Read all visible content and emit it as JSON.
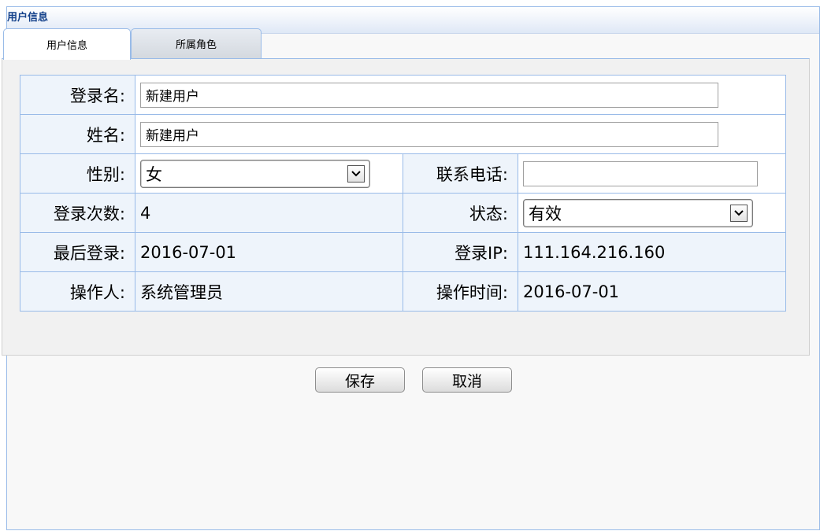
{
  "panel": {
    "title": "用户信息"
  },
  "tabs": [
    {
      "label": "用户信息",
      "active": true
    },
    {
      "label": "所属角色",
      "active": false
    }
  ],
  "form": {
    "login_name": {
      "label": "登录名:",
      "value": "新建用户"
    },
    "full_name": {
      "label": "姓名:",
      "value": "新建用户"
    },
    "gender": {
      "label": "性别:",
      "selected": "女"
    },
    "phone": {
      "label": "联系电话:",
      "value": ""
    },
    "login_count": {
      "label": "登录次数:",
      "value": "4"
    },
    "status": {
      "label": "状态:",
      "selected": "有效"
    },
    "last_login": {
      "label": "最后登录:",
      "value": "2016-07-01"
    },
    "login_ip": {
      "label": "登录IP:",
      "value": "111.164.216.160"
    },
    "operator": {
      "label": "操作人:",
      "value": "系统管理员"
    },
    "operation_time": {
      "label": "操作时间:",
      "value": "2016-07-01"
    }
  },
  "buttons": {
    "save": "保存",
    "cancel": "取消"
  },
  "colors": {
    "border": "#99bbe8",
    "title": "#15428b",
    "label_bg": "#eef4fb"
  }
}
